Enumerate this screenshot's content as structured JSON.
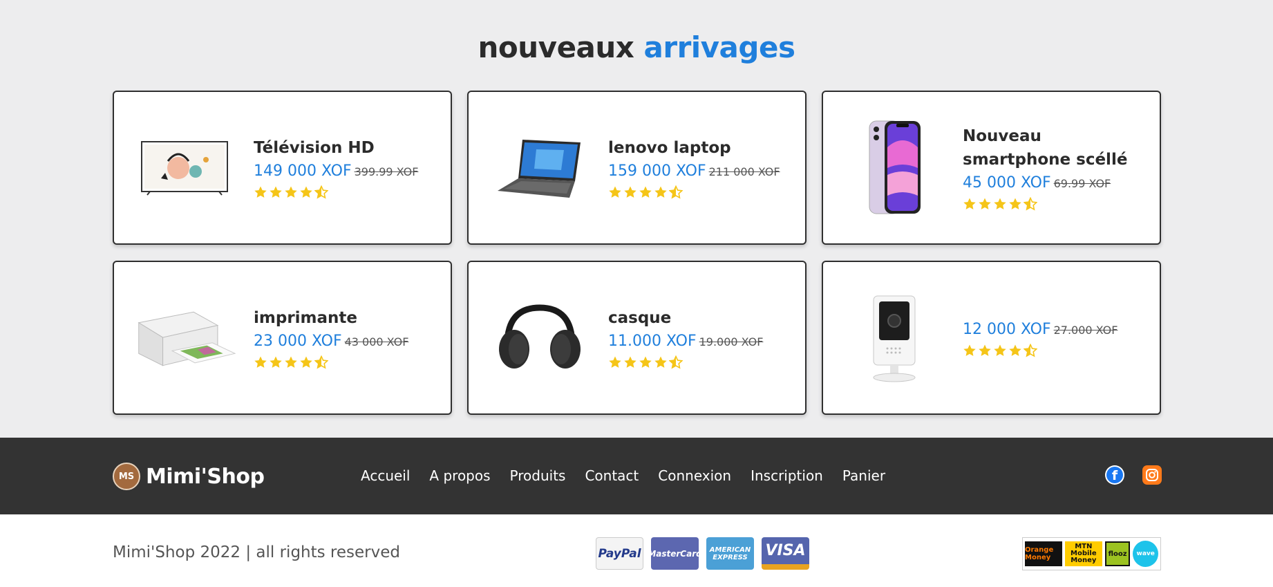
{
  "section": {
    "title_part1": "nouveaux",
    "title_part2": "arrivages"
  },
  "products": [
    {
      "name": "Télévision HD",
      "price": "149 000 XOF",
      "old_price": "399.99 XOF",
      "rating": 4.5,
      "image": "tv"
    },
    {
      "name": "lenovo laptop",
      "price": "159 000 XOF",
      "old_price": "211 000 XOF",
      "rating": 4.5,
      "image": "laptop"
    },
    {
      "name": "Nouveau smartphone scéllé",
      "price": "45 000 XOF",
      "old_price": "69.99 XOF",
      "rating": 4.5,
      "image": "smartphone"
    },
    {
      "name": "imprimante",
      "price": "23 000 XOF",
      "old_price": "43 000 XOF",
      "rating": 4.5,
      "image": "printer"
    },
    {
      "name": "casque",
      "price": "11.000 XOF",
      "old_price": "19.000 XOF",
      "rating": 4.5,
      "image": "headphones"
    },
    {
      "name": "",
      "price": "12 000 XOF",
      "old_price": "27.000 XOF",
      "rating": 4.5,
      "image": "camera"
    }
  ],
  "footer": {
    "brand_initials": "MS",
    "brand_name": "Mimi'Shop",
    "nav": [
      "Accueil",
      "A propos",
      "Produits",
      "Contact",
      "Connexion",
      "Inscription",
      "Panier"
    ],
    "social": [
      "facebook-icon",
      "instagram-icon"
    ],
    "copyright": "Mimi'Shop 2022 | all rights reserved",
    "payment_cards": [
      "PayPal",
      "MasterCard",
      "AMERICAN EXPRESS",
      "VISA"
    ],
    "mobile_payments": [
      "Orange Money",
      "MTN Mobile Money",
      "flooz",
      "wave"
    ]
  },
  "colors": {
    "accent": "#1f7fdc",
    "star": "#f5c518",
    "footer_bg": "#333333",
    "page_bg": "#ededee"
  }
}
